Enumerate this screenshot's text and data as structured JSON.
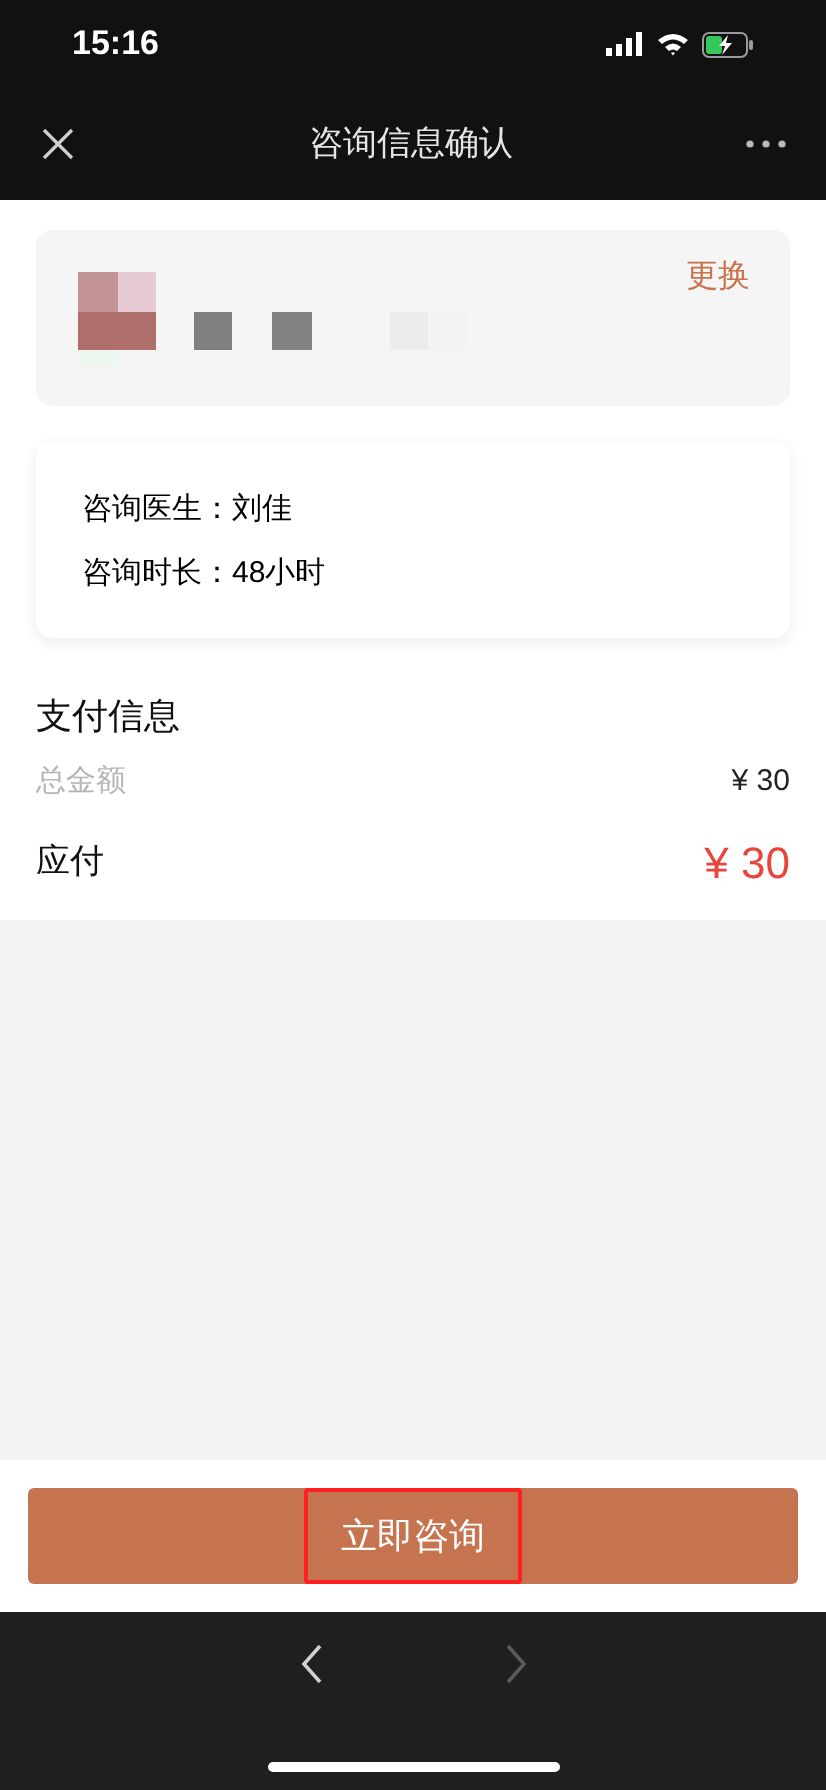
{
  "status_bar": {
    "time": "15:16"
  },
  "nav_bar": {
    "title": "咨询信息确认"
  },
  "patient_card": {
    "change_link": "更换"
  },
  "consult_card": {
    "lines": [
      {
        "label": "咨询医生：",
        "value": "刘佳"
      },
      {
        "label": "咨询时长：",
        "value": "48小时"
      }
    ]
  },
  "payment": {
    "title": "支付信息",
    "rows": [
      {
        "kind": "total",
        "label": "总金额",
        "amount": "¥ 30"
      },
      {
        "kind": "due",
        "label": "应付",
        "amount": "¥ 30"
      }
    ]
  },
  "submit_button": {
    "label": "立即咨询",
    "highlighted": true
  },
  "browser_nav": [
    {
      "kind": "back",
      "disabled": false
    },
    {
      "kind": "forward",
      "disabled": true
    }
  ]
}
